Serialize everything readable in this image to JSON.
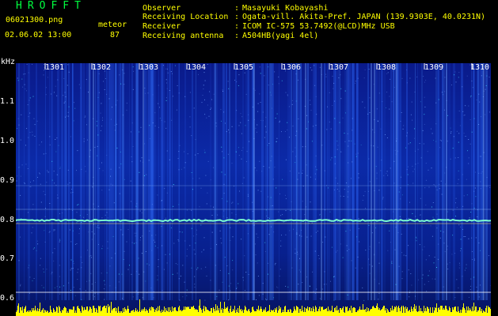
{
  "header": {
    "title": "HROFFT",
    "file_name": "06021300.png",
    "datetime": "02.06.02 13:00",
    "meteor_label": "meteor",
    "meteor_count": "87"
  },
  "info": [
    {
      "label": "Observer",
      "value": "Masayuki Kobayashi"
    },
    {
      "label": "Receiving Location",
      "value": "Ogata-vill. Akita-Pref. JAPAN (139.9303E, 40.0231N)"
    },
    {
      "label": "Receiver",
      "value": "ICOM IC-575 53.7492(@LCD)MHz USB"
    },
    {
      "label": "Receiving antenna",
      "value": "A504HB(yagi 4el)"
    }
  ],
  "axis": {
    "y_unit": "kHz",
    "y_ticks": [
      "1.1",
      "1.0",
      "0.9",
      "0.8",
      "0.7",
      "0.6"
    ],
    "x_ticks": [
      "1301",
      "1302",
      "1303",
      "1304",
      "1305",
      "1306",
      "1307",
      "1308",
      "1309",
      "1310"
    ]
  },
  "colors": {
    "title": "#00ff40",
    "labels": "#ffff00",
    "background": "#000000",
    "signal": "#ffff00"
  }
}
